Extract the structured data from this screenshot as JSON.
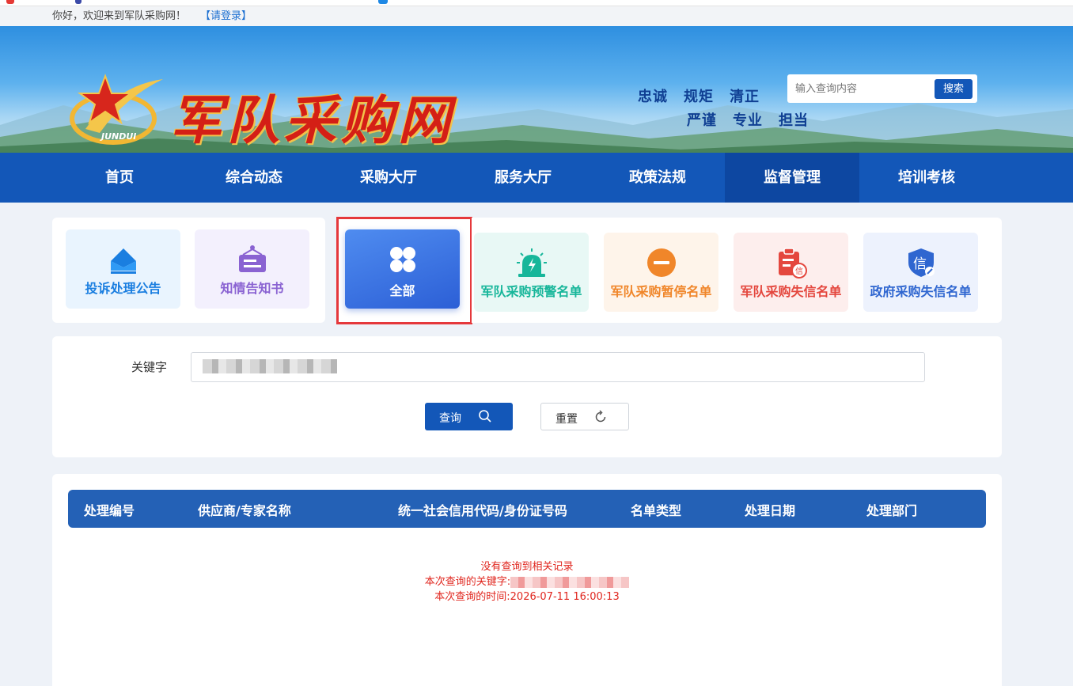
{
  "topbar": {
    "welcome": "你好，欢迎来到军队采购网！",
    "login_link": "【请登录】"
  },
  "header": {
    "site_title": "军队采购网",
    "emblem_text": "JUNDUI",
    "motto_line1": [
      "忠诚",
      "规矩",
      "清正"
    ],
    "motto_line2": [
      "严谨",
      "专业",
      "担当"
    ],
    "search_placeholder": "输入查询内容",
    "search_button": "搜索"
  },
  "nav": {
    "items": [
      "首页",
      "综合动态",
      "采购大厅",
      "服务大厅",
      "政策法规",
      "监督管理",
      "培训考核"
    ],
    "active": "监督管理"
  },
  "categories": {
    "left": [
      {
        "label": "投诉处理公告",
        "color": "#1a7ee0",
        "bg": "#e9f4fe",
        "icon": "envelope-icon"
      },
      {
        "label": "知情告知书",
        "color": "#8a63d2",
        "bg": "#f3f0fd",
        "icon": "notice-board-icon"
      }
    ],
    "all": {
      "label": "全部",
      "icon": "grid-icon"
    },
    "right": [
      {
        "label": "军队采购预警名单",
        "color": "#17b69a",
        "bg": "#e8f8f5",
        "icon": "alarm-light-icon"
      },
      {
        "label": "军队采购暂停名单",
        "color": "#f0862a",
        "bg": "#fef4ea",
        "icon": "pause-circle-icon"
      },
      {
        "label": "军队采购失信名单",
        "color": "#e4473e",
        "bg": "#fdeeed",
        "icon": "dishonest-clipboard-icon"
      },
      {
        "label": "政府采购失信名单",
        "color": "#2f66d0",
        "bg": "#edf2fd",
        "icon": "credit-shield-icon"
      }
    ]
  },
  "search_form": {
    "keyword_label": "关键字",
    "keyword_value": "",
    "query_button": "查询",
    "reset_button": "重置"
  },
  "results": {
    "columns": [
      "处理编号",
      "供应商/专家名称",
      "统一社会信用代码/身份证号码",
      "名单类型",
      "处理日期",
      "处理部门"
    ],
    "empty_message": "没有查询到相关记录",
    "keyword_prefix": "本次查询的关键字:",
    "time_line": "本次查询的时间:2026-07-11 16:00:13"
  }
}
